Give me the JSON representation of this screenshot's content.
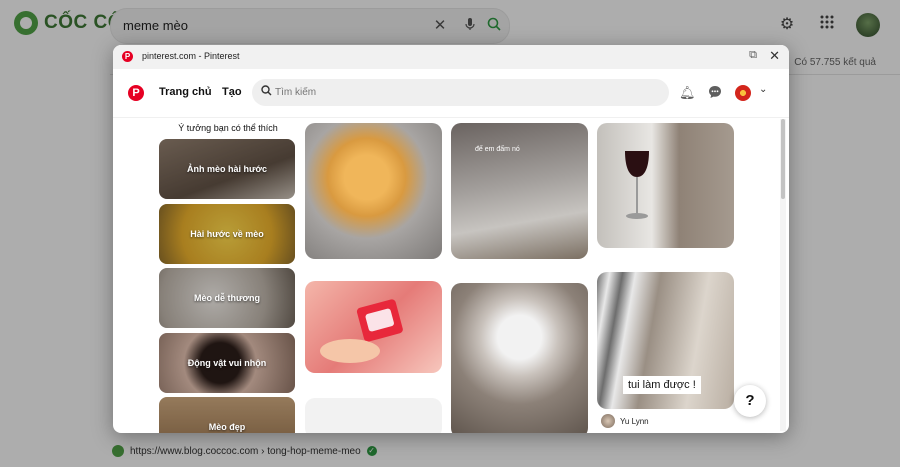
{
  "browser_page": {
    "logo_text": "CỐC CỐC",
    "search_query": "meme mèo",
    "result_count": "Có 57.755 kết quả",
    "bottom_link": "https://www.blog.coccoc.com › tong-hop-meme-meo",
    "icons": [
      "clear-icon",
      "mic-icon",
      "search-icon",
      "settings-icon",
      "apps-grid-icon",
      "avatar"
    ]
  },
  "popup": {
    "title": "pinterest.com - Pinterest",
    "open_external_icon": "external-link-icon",
    "close_icon": "close-icon"
  },
  "pinterest": {
    "nav_home": "Trang chủ",
    "nav_create": "Tạo",
    "search_placeholder": "Tìm kiếm",
    "ideas_heading": "Ý tưởng bạn có thể thích",
    "ideas": [
      {
        "label": "Ảnh mèo hài hước"
      },
      {
        "label": "Hài hước về mèo"
      },
      {
        "label": "Mèo dễ thương"
      },
      {
        "label": "Động vật vui nhộn"
      },
      {
        "label": "Mèo đẹp"
      }
    ],
    "pin_caption_1": "đế em đấm nó",
    "pin_caption_2": "tui làm được !",
    "pin_author": "Yu Lynn",
    "help_label": "?"
  }
}
